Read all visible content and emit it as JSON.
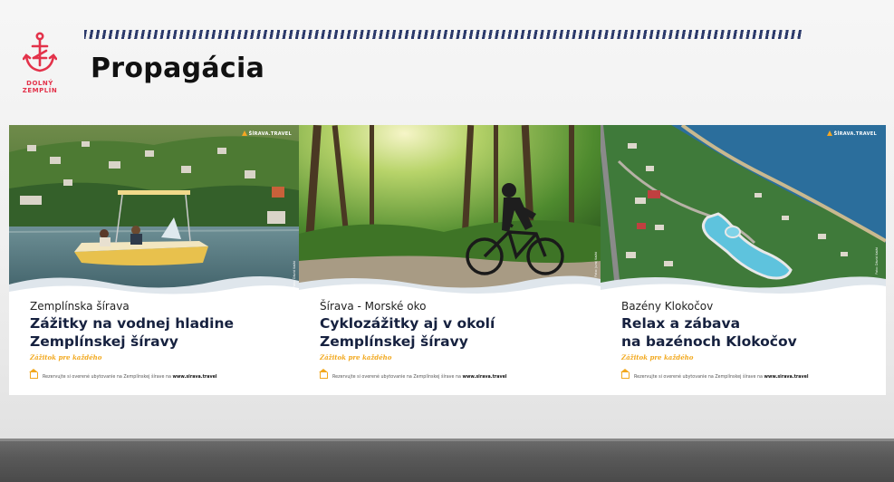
{
  "logo": {
    "line1": "DOLNÝ",
    "line2": "ZEMPLÍN",
    "color": "#e3324a"
  },
  "slide": {
    "title": "Propagácia"
  },
  "posters": [
    {
      "brand": "ŠÍRAVA.TRAVEL",
      "subtitle": "Zemplínska šírava",
      "headline_line1": "Zážitky na vodnej hladine",
      "headline_line2": "Zemplínskej šíravy",
      "tagline": "Zážitok pre každého",
      "footer_text": "Rezervujte si overené ubytovanie na Zemplínskej šírave na ",
      "footer_link": "www.sirava.travel",
      "photo_credit": "Foto: Dávid Kalát"
    },
    {
      "brand": "",
      "subtitle": "Šírava - Morské oko",
      "headline_line1": "Cyklozážitky aj v okolí",
      "headline_line2": "Zemplínskej šíravy",
      "tagline": "Zážitok pre každého",
      "footer_text": "Rezervujte si overené ubytovanie na Zemplínskej šírave na ",
      "footer_link": "www.sirava.travel",
      "photo_credit": "Foto: Juraj Kalát"
    },
    {
      "brand": "ŠÍRAVA.TRAVEL",
      "subtitle": "Bazény Klokočov",
      "headline_line1": "Relax a zábava",
      "headline_line2": "na bazénoch Klokočov",
      "tagline": "Zážitok pre každého",
      "footer_text": "Rezervujte si overené ubytovanie na Zemplínskej šírave na ",
      "footer_link": "www.sirava.travel",
      "photo_credit": "Foto: Dávid Kalát"
    }
  ],
  "colors": {
    "headline": "#16213f",
    "accent": "#f2a81d",
    "stripe": "#2c3a6b"
  }
}
